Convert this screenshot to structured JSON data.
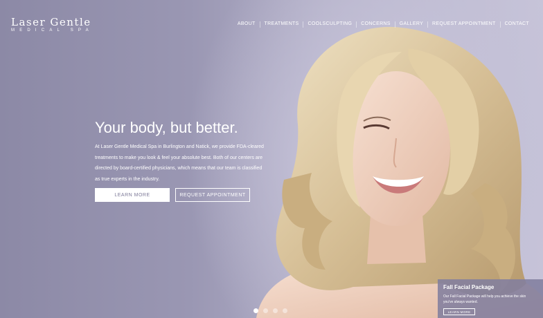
{
  "brand": {
    "name_line1": "Laser Gentle",
    "name_line2": "MEDICAL SPA"
  },
  "nav": {
    "items": [
      {
        "label": "ABOUT"
      },
      {
        "label": "TREATMENTS"
      },
      {
        "label": "COOLSCULPTING"
      },
      {
        "label": "CONCERNS"
      },
      {
        "label": "GALLERY"
      },
      {
        "label": "REQUEST APPOINTMENT"
      },
      {
        "label": "CONTACT"
      }
    ]
  },
  "hero": {
    "headline": "Your body, but better.",
    "intro": "At Laser Gentle Medical Spa in Burlington and Natick, we provide FDA-cleared treatments to make you look & feel your absolute best. Both of our centers are directed by board-certified physicians, which means that our team is classified as true experts in the industry.",
    "learn_more_label": "LEARN MORE",
    "request_label": "REQUEST APPOINTMENT"
  },
  "slider": {
    "active_index": 0,
    "count": 4
  },
  "promo": {
    "title": "Fall Facial Package",
    "text": "Our Fall Facial Package will help you achieve the skin you've always wanted.",
    "button_label": "LEARN MORE"
  },
  "colors": {
    "background": "#8f8ca8",
    "button_text": "#7d7a98",
    "hair": "#d8c29a",
    "skin": "#eecfbd"
  }
}
